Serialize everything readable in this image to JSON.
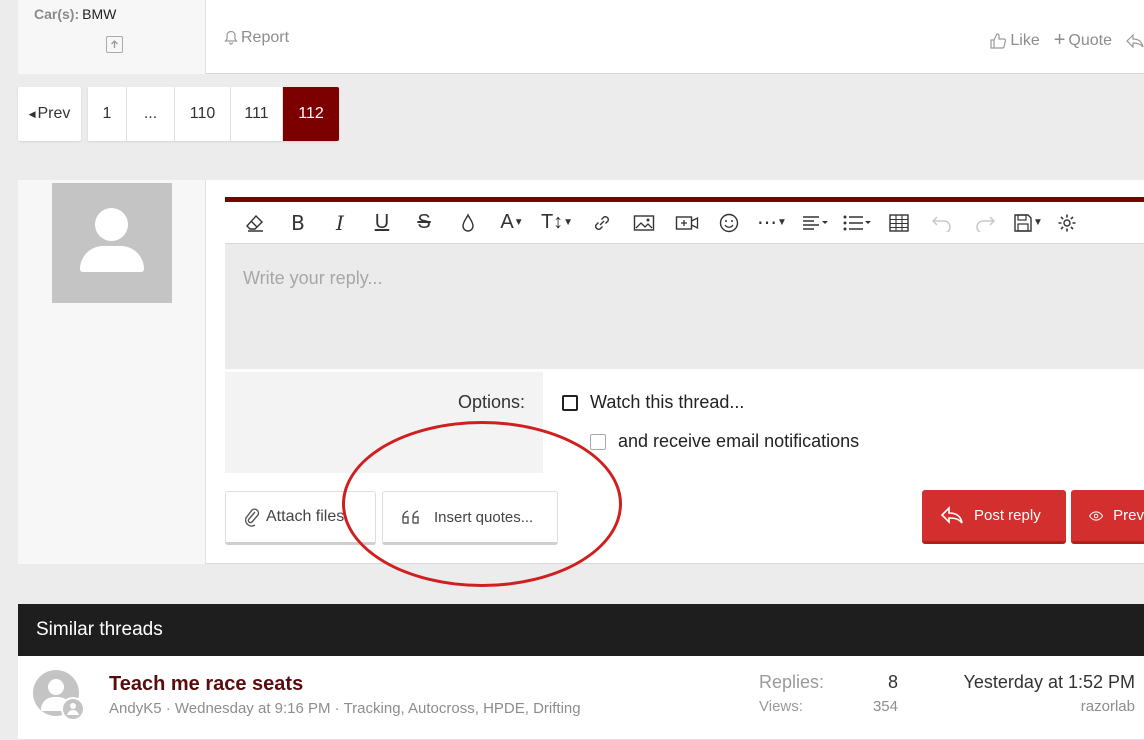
{
  "post": {
    "cars_label": "Car(s):",
    "cars_value": "BMW",
    "report_label": "Report",
    "like_label": "Like",
    "quote_label": "Quote"
  },
  "pagination": {
    "prev_label": "Prev",
    "pages": [
      "1",
      "...",
      "110",
      "111",
      "112"
    ],
    "current": "112"
  },
  "editor": {
    "placeholder": "Write your reply..."
  },
  "options": {
    "label": "Options:",
    "watch_label": "Watch this thread...",
    "email_label": "and receive email notifications"
  },
  "buttons": {
    "attach_label": "Attach files",
    "insert_quotes_label": "Insert quotes...",
    "post_reply_label": "Post reply",
    "preview_label": "Prev"
  },
  "similar": {
    "heading": "Similar threads",
    "threads": [
      {
        "title": "Teach me race seats",
        "meta": "AndyK5 · Wednesday at 9:16 PM · Tracking, Autocross, HPDE, Drifting",
        "replies_label": "Replies:",
        "replies": "8",
        "views_label": "Views:",
        "views": "354",
        "last_date": "Yesterday at 1:52 PM",
        "last_user": "razorlab"
      }
    ]
  },
  "colors": {
    "accent": "#7c0000",
    "primary_button": "#d32f2f",
    "annotation": "#d01f1f"
  }
}
